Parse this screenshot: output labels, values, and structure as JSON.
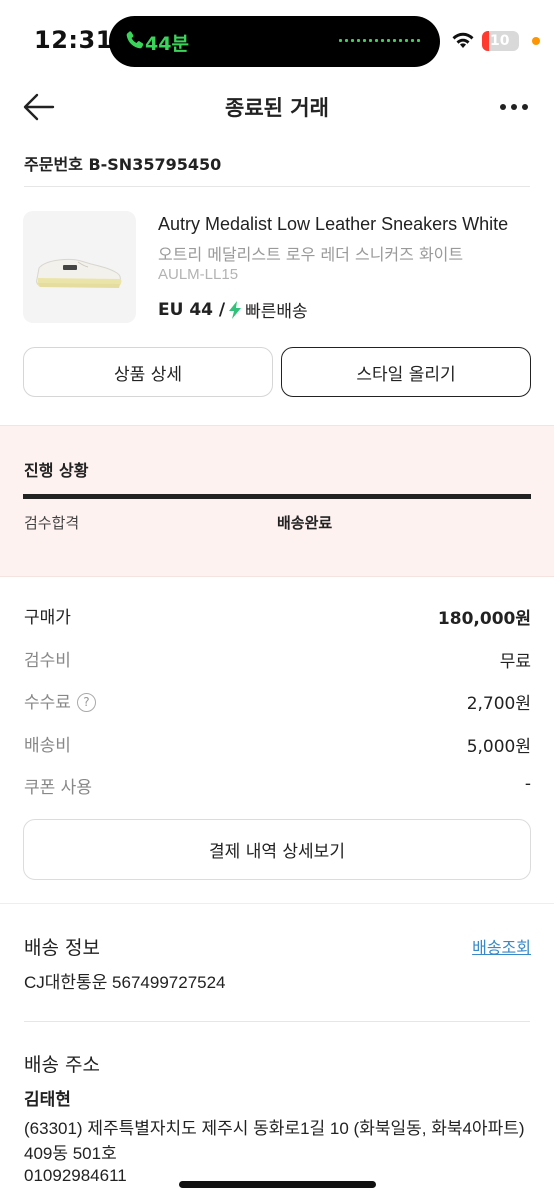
{
  "status_bar": {
    "time": "12:31",
    "call_text": "44분",
    "battery_level": "10"
  },
  "header": {
    "title": "종료된 거래"
  },
  "order": {
    "number": "주문번호 B-SN35795450"
  },
  "product": {
    "name": "Autry Medalist Low Leather Sneakers White",
    "name_kor": "오트리 메달리스트 로우 레더 스니커즈 화이트",
    "code": "AULM-LL15",
    "size": "EU 44 /",
    "delivery_type": "빠른배송"
  },
  "buttons": {
    "product_detail": "상품 상세",
    "post_style": "스타일 올리기",
    "payment_detail": "결제 내역 상세보기"
  },
  "progress": {
    "title": "진행 상황",
    "steps": [
      "검수합격",
      "배송완료"
    ],
    "fill_fraction": 1.0
  },
  "pricing": {
    "rows": [
      {
        "label": "구매가",
        "value": "180,000원"
      },
      {
        "label": "검수비",
        "value": "무료"
      },
      {
        "label": "수수료",
        "value": "2,700원"
      },
      {
        "label": "배송비",
        "value": "5,000원"
      },
      {
        "label": "쿠폰 사용",
        "value": "-"
      }
    ]
  },
  "shipping": {
    "title": "배송 정보",
    "tracking_link": "배송조회",
    "carrier_number": "CJ대한통운 567499727524"
  },
  "address": {
    "title": "배송 주소",
    "name": "김태현",
    "address": "(63301) 제주특별자치도 제주시 동화로1길 10 (화북일동, 화북4아파트) 409동 501호",
    "phone": "01092984611"
  },
  "colors": {
    "accent_green": "#3bd45a",
    "progress_bg": "#fdf2f0",
    "link_blue": "#3789c9"
  }
}
